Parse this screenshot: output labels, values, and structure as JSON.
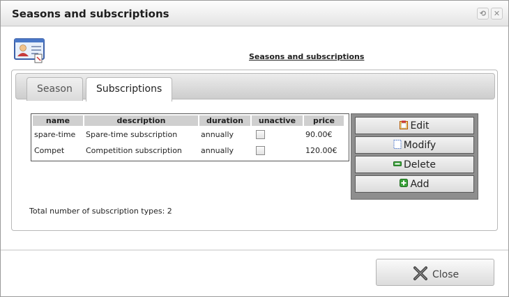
{
  "window": {
    "title": "Seasons and subscriptions"
  },
  "titlebar_buttons": {
    "restore": "⟲",
    "close": "✕"
  },
  "header": {
    "icon": "id-card-icon",
    "heading": "Seasons and subscriptions"
  },
  "tabs": [
    {
      "label": "Season",
      "active": false
    },
    {
      "label": "Subscriptions",
      "active": true
    }
  ],
  "table": {
    "columns": [
      "name",
      "description",
      "duration",
      "unactive",
      "price"
    ],
    "rows": [
      {
        "name": "spare-time",
        "description": "Spare-time subscription",
        "duration": "annually",
        "unactive": false,
        "price": "90.00€"
      },
      {
        "name": "Compet",
        "description": "Competition subscription",
        "duration": "annually",
        "unactive": false,
        "price": "120.00€"
      }
    ]
  },
  "actions": {
    "edit": {
      "label": "Edit",
      "icon": "clipboard-icon"
    },
    "modify": {
      "label": "Modify",
      "icon": "dotted-page-icon"
    },
    "delete": {
      "label": "Delete",
      "icon": "minus-icon"
    },
    "add": {
      "label": "Add",
      "icon": "plus-icon"
    }
  },
  "summary": "Total number of subscription types: 2",
  "close_button": {
    "label": "Close",
    "icon": "close-x-icon"
  }
}
